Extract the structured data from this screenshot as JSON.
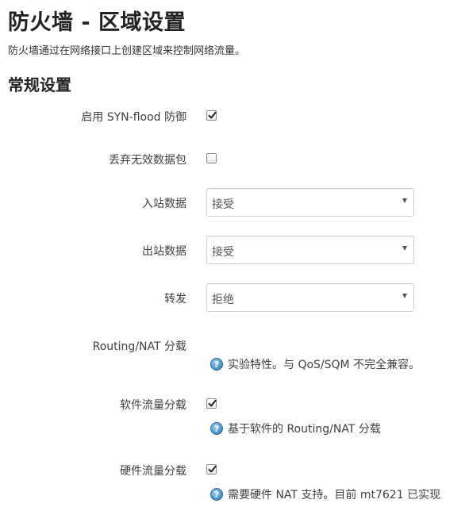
{
  "page": {
    "title": "防火墙 - 区域设置",
    "description": "防火墙通过在网络接口上创建区域来控制网络流量。"
  },
  "general": {
    "section_title": "常规设置",
    "syn_flood": {
      "label": "启用 SYN-flood 防御",
      "checked": true
    },
    "drop_invalid": {
      "label": "丢弃无效数据包",
      "checked": false
    },
    "input": {
      "label": "入站数据",
      "value": "接受"
    },
    "output": {
      "label": "出站数据",
      "value": "接受"
    },
    "forward": {
      "label": "转发",
      "value": "拒绝"
    },
    "routing_nat_offload": {
      "label": "Routing/NAT 分载",
      "help_text": "实验特性。与 QoS/SQM 不完全兼容。"
    },
    "software_offload": {
      "label": "软件流量分载",
      "checked": true,
      "help_text": "基于软件的 Routing/NAT 分载"
    },
    "hardware_offload": {
      "label": "硬件流量分载",
      "checked": true,
      "help_text": "需要硬件 NAT 支持。目前 mt7621 已实现"
    }
  },
  "icons": {
    "help": "help-question-icon",
    "check": "checkmark-icon",
    "dropdown": "chevron-down-icon"
  },
  "colors": {
    "help_icon": "#3d8fc8",
    "text": "#333333"
  }
}
